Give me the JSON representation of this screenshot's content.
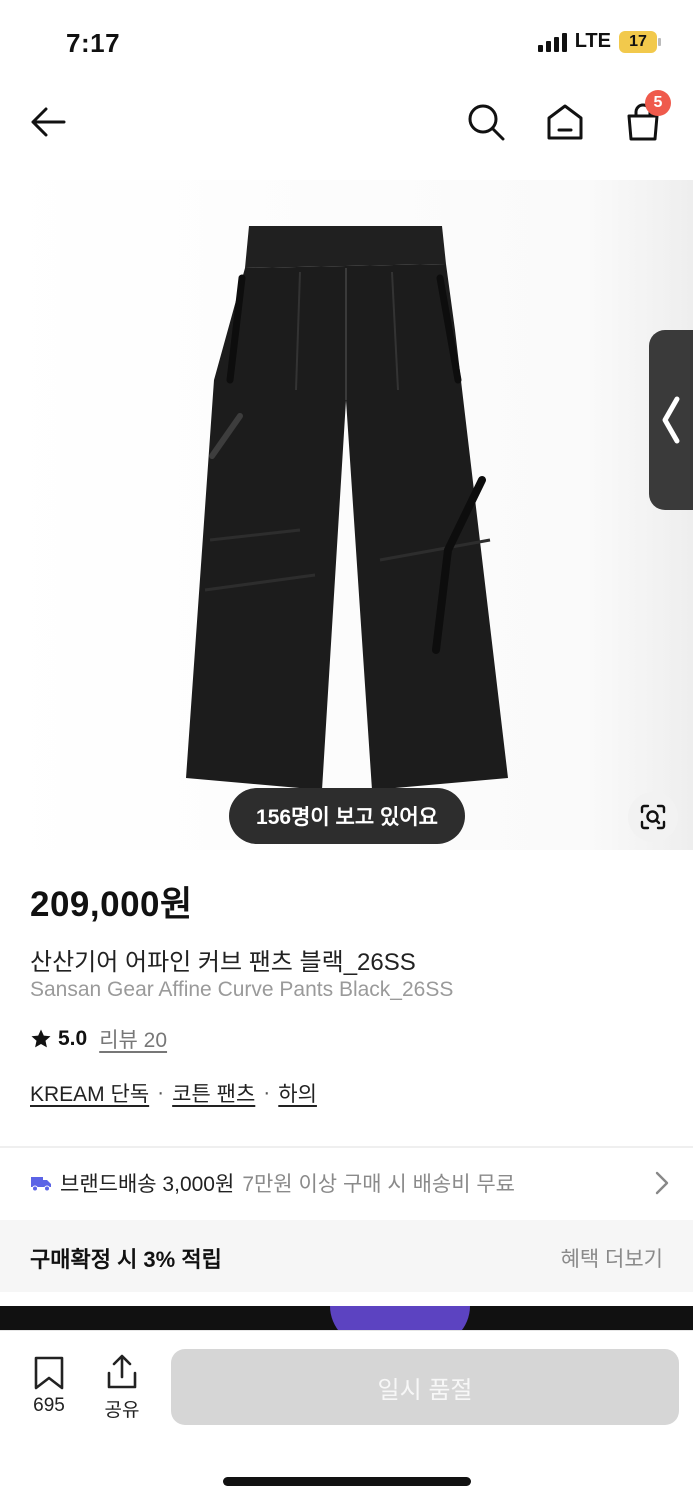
{
  "status_bar": {
    "time": "7:17",
    "network": "LTE",
    "battery": "17"
  },
  "header": {
    "back_icon": "arrow-left-icon",
    "search_icon": "search-icon",
    "home_icon": "home-icon",
    "cart_icon": "shopping-bag-icon",
    "cart_count": "5"
  },
  "gallery": {
    "viewers_text": "156명이 보고 있어요",
    "side_tab_icon": "chevron-left-icon",
    "lens_icon": "visual-search-icon"
  },
  "product": {
    "price": "209,000원",
    "name_ko": "산산기어 어파인 커브 팬츠 블랙_26SS",
    "name_en": "Sansan Gear Affine Curve Pants Black_26SS",
    "rating": "5.0",
    "review_label": "리뷰 20",
    "categories": [
      "KREAM 단독",
      "코튼 팬츠",
      "하의"
    ],
    "category_separator": "·"
  },
  "shipping": {
    "icon": "truck-icon",
    "label": "브랜드배송 3,000원",
    "note": "7만원 이상 구매 시 배송비 무료"
  },
  "benefit": {
    "label": "구매확정 시 3% 적립",
    "more": "혜택 더보기"
  },
  "bottom_bar": {
    "bookmark_count": "695",
    "share_label": "공유",
    "action_button": "일시 품절"
  },
  "colors": {
    "badge": "#ef5a4c",
    "truck": "#5b63e6",
    "disabled_button": "#d6d6d6",
    "pill": "#2d2d2d"
  }
}
